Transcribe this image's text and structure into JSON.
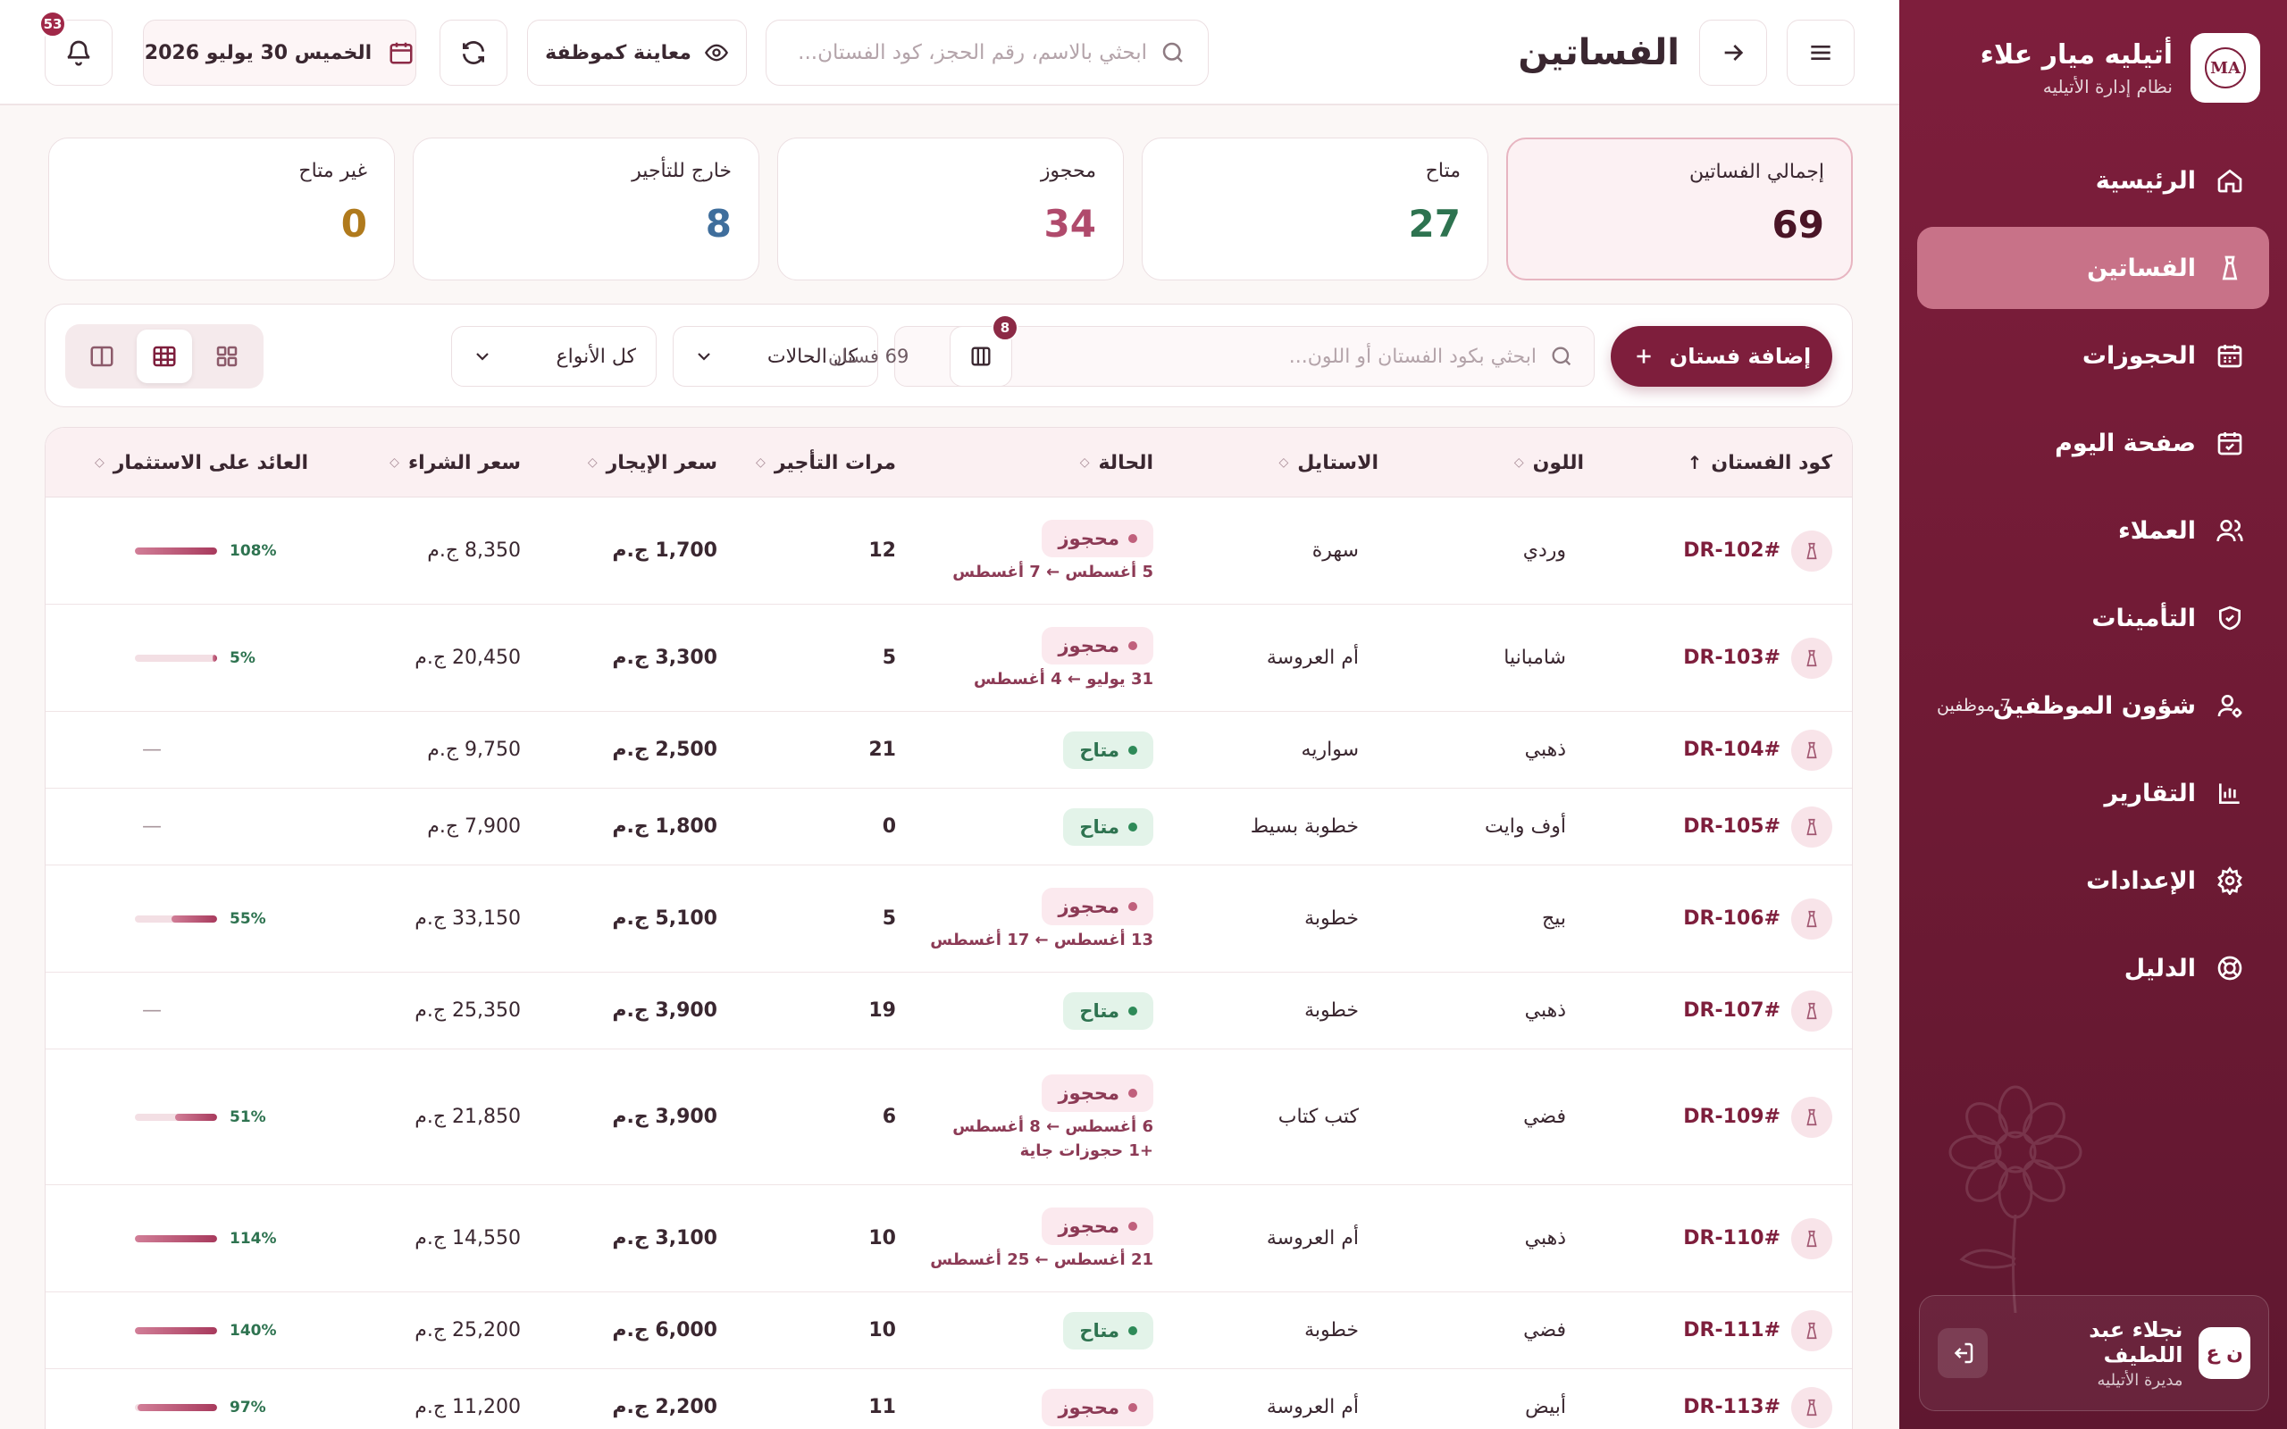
{
  "sidebar": {
    "logo_text": "MA",
    "brand_name": "أتيليه ميار علاء",
    "brand_sub": "نظام إدارة الأتيليه",
    "items": [
      {
        "label": "الرئيسية",
        "icon": "home-icon"
      },
      {
        "label": "الفساتين",
        "icon": "dress-icon",
        "active": true
      },
      {
        "label": "الحجوزات",
        "icon": "calendar-icon"
      },
      {
        "label": "صفحة اليوم",
        "icon": "calendar-check-icon"
      },
      {
        "label": "العملاء",
        "icon": "users-icon"
      },
      {
        "label": "التأمينات",
        "icon": "shield-icon"
      },
      {
        "label": "شؤون الموظفين",
        "icon": "user-gear-icon",
        "badge": "7 موظفين"
      },
      {
        "label": "التقارير",
        "icon": "chart-icon"
      },
      {
        "label": "الإعدادات",
        "icon": "gear-icon"
      },
      {
        "label": "الدليل",
        "icon": "lifebuoy-icon"
      }
    ],
    "user": {
      "initials": "ن ع",
      "name": "نجلاء عبد اللطيف",
      "role": "مديرة الأتيليه"
    }
  },
  "topbar": {
    "title": "الفساتين",
    "search_placeholder": "ابحثي بالاسم، رقم الحجز، كود الفستان...",
    "preview_label": "معاينة كموظفة",
    "date_label": "الخميس 30 يوليو 2026",
    "notifications_count": "53"
  },
  "stats": [
    {
      "label": "إجمالي الفساتين",
      "value": "69",
      "color": "#4a1526"
    },
    {
      "label": "متاح",
      "value": "27",
      "color": "#2e7350"
    },
    {
      "label": "محجوز",
      "value": "34",
      "color": "#b04a6c"
    },
    {
      "label": "خارج للتأجير",
      "value": "8",
      "color": "#3f6e9c"
    },
    {
      "label": "غير متاح",
      "value": "0",
      "color": "#b07a1c"
    }
  ],
  "toolbar": {
    "add_label": "إضافة فستان",
    "search_placeholder": "ابحثي بكود الفستان أو اللون...",
    "status_filter": "كل الحالات",
    "type_filter": "كل الأنواع",
    "columns_badge": "8",
    "count_text": "69 فستان"
  },
  "table": {
    "headers": [
      "كود الفستان",
      "اللون",
      "الاستايل",
      "الحالة",
      "مرات التأجير",
      "سعر الإيجار",
      "سعر الشراء",
      "العائد على الاستثمار"
    ],
    "rows": [
      {
        "code": "#DR-102",
        "color": "وردي",
        "style": "سهرة",
        "status": "محجوز",
        "status_type": "reserved",
        "dates": "5 أغسطس ← 7 أغسطس",
        "extra": "",
        "rentals": "12",
        "rent": "1,700 ج.م",
        "buy": "8,350 ج.م",
        "roi": "108%",
        "roi_value": 1.08
      },
      {
        "code": "#DR-103",
        "color": "شامبانيا",
        "style": "أم العروسة",
        "status": "محجوز",
        "status_type": "reserved",
        "dates": "31 يوليو ← 4 أغسطس",
        "extra": "",
        "rentals": "5",
        "rent": "3,300 ج.م",
        "buy": "20,450 ج.م",
        "roi": "5%",
        "roi_value": 0.05
      },
      {
        "code": "#DR-104",
        "color": "ذهبي",
        "style": "سواريه",
        "status": "متاح",
        "status_type": "avail",
        "dates": "",
        "extra": "",
        "rentals": "21",
        "rent": "2,500 ج.م",
        "buy": "9,750 ج.م",
        "roi": "—",
        "roi_value": null
      },
      {
        "code": "#DR-105",
        "color": "أوف وايت",
        "style": "خطوبة بسيط",
        "status": "متاح",
        "status_type": "avail",
        "dates": "",
        "extra": "",
        "rentals": "0",
        "rent": "1,800 ج.م",
        "buy": "7,900 ج.م",
        "roi": "—",
        "roi_value": null
      },
      {
        "code": "#DR-106",
        "color": "بيج",
        "style": "خطوبة",
        "status": "محجوز",
        "status_type": "reserved",
        "dates": "13 أغسطس ← 17 أغسطس",
        "extra": "",
        "rentals": "5",
        "rent": "5,100 ج.م",
        "buy": "33,150 ج.م",
        "roi": "55%",
        "roi_value": 0.55
      },
      {
        "code": "#DR-107",
        "color": "ذهبي",
        "style": "خطوبة",
        "status": "متاح",
        "status_type": "avail",
        "dates": "",
        "extra": "",
        "rentals": "19",
        "rent": "3,900 ج.م",
        "buy": "25,350 ج.م",
        "roi": "—",
        "roi_value": null
      },
      {
        "code": "#DR-109",
        "color": "فضي",
        "style": "كتب كتاب",
        "status": "محجوز",
        "status_type": "reserved",
        "dates": "6 أغسطس ← 8 أغسطس",
        "extra": "+1 حجوزات جاية",
        "rentals": "6",
        "rent": "3,900 ج.م",
        "buy": "21,850 ج.م",
        "roi": "51%",
        "roi_value": 0.51
      },
      {
        "code": "#DR-110",
        "color": "ذهبي",
        "style": "أم العروسة",
        "status": "محجوز",
        "status_type": "reserved",
        "dates": "21 أغسطس ← 25 أغسطس",
        "extra": "",
        "rentals": "10",
        "rent": "3,100 ج.م",
        "buy": "14,550 ج.م",
        "roi": "114%",
        "roi_value": 1.14
      },
      {
        "code": "#DR-111",
        "color": "فضي",
        "style": "خطوبة",
        "status": "متاح",
        "status_type": "avail",
        "dates": "",
        "extra": "",
        "rentals": "10",
        "rent": "6,000 ج.م",
        "buy": "25,200 ج.م",
        "roi": "140%",
        "roi_value": 1.4
      },
      {
        "code": "#DR-113",
        "color": "أبيض",
        "style": "أم العروسة",
        "status": "محجوز",
        "status_type": "reserved",
        "dates": "",
        "extra": "",
        "rentals": "11",
        "rent": "2,200 ج.م",
        "buy": "11,200 ج.م",
        "roi": "97%",
        "roi_value": 0.97
      }
    ]
  }
}
